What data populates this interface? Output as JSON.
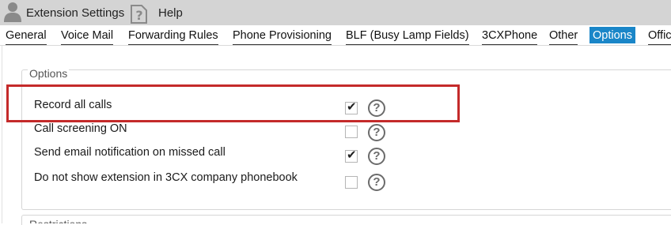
{
  "toolbar": {
    "extension_settings_label": "Extension Settings",
    "help_label": "Help",
    "icons": [
      "person-icon",
      "help-question-icon"
    ]
  },
  "tabs": [
    {
      "label": "General",
      "active": false
    },
    {
      "label": "Voice Mail",
      "active": false
    },
    {
      "label": "Forwarding Rules",
      "active": false
    },
    {
      "label": "Phone Provisioning",
      "active": false
    },
    {
      "label": "BLF (Busy Lamp Fields)",
      "active": false
    },
    {
      "label": "3CXPhone",
      "active": false
    },
    {
      "label": "Other",
      "active": false
    },
    {
      "label": "Options",
      "active": true
    },
    {
      "label": "Offic",
      "active": false
    }
  ],
  "options_panel": {
    "title": "Options",
    "items": [
      {
        "label": "Record all calls",
        "checked": true,
        "highlighted": true
      },
      {
        "label": "Call screening ON",
        "checked": false
      },
      {
        "label": "Send email notification on missed call",
        "checked": true
      },
      {
        "label": "Do not show extension in 3CX company phonebook",
        "checked": false
      }
    ],
    "check_glyph": "✔",
    "help_glyph": "?"
  },
  "restrictions_panel": {
    "title": "Restrictions"
  },
  "colors": {
    "toolbar_bg": "#d4d4d4",
    "active_tab_bg": "#1a86c8",
    "highlight_border": "#c42a2a"
  }
}
